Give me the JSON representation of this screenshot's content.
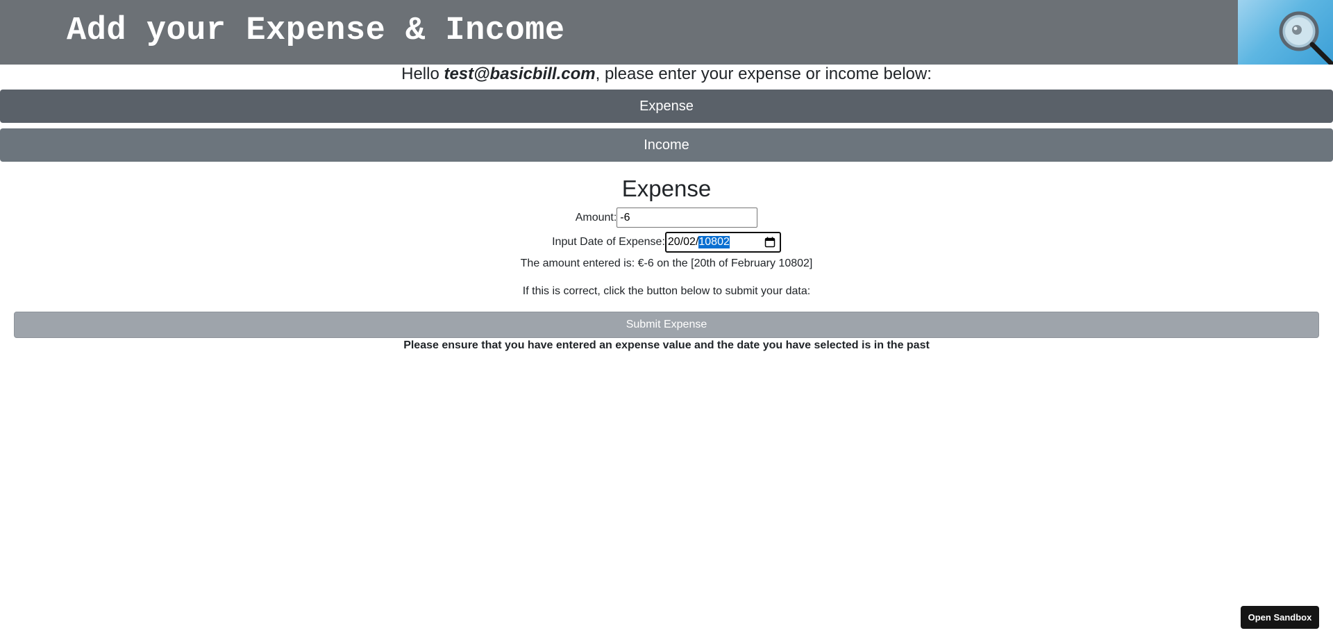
{
  "header": {
    "title": "Add your Expense & Income",
    "logo_icon": "magnifier-icon"
  },
  "greeting": {
    "prefix": "Hello ",
    "email": "test@basicbill.com",
    "suffix": ", please enter your expense or income below:"
  },
  "tabs": [
    {
      "label": "Expense",
      "active": true,
      "color": "#5a6169"
    },
    {
      "label": "Income",
      "active": false,
      "color": "#6c757d"
    }
  ],
  "form": {
    "title": "Expense",
    "amount_label": "Amount:",
    "amount_value": "-6",
    "date_label": "Input Date of Expense:",
    "date_day_month": "20/02/",
    "date_year_selected": "10802",
    "date_icon": "calendar-icon",
    "amount_summary": "The amount entered is: €-6 on the [20th of February 10802]",
    "confirm_text": "If this is correct, click the button below to submit your data:",
    "submit_label": "Submit Expense",
    "warning": "Please ensure that you have entered an expense value and the date you have selected is in the past"
  },
  "footer": {
    "sandbox_label": "Open Sandbox"
  },
  "colors": {
    "header_bg": "#6c7176",
    "selection": "#0a6fd1",
    "submit_disabled": "#9ea4ab"
  }
}
